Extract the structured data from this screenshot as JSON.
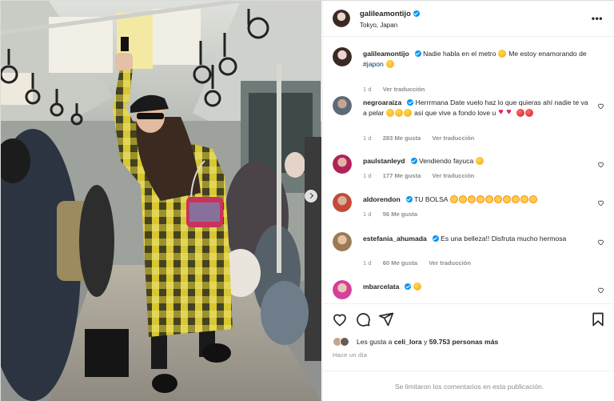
{
  "post": {
    "username": "galileamontijo",
    "location": "Tokyo, Japan",
    "more_icon": "more-horizontal-icon",
    "caption": {
      "username": "galileamontijo",
      "text_before": "Nadie habla en el metro",
      "text_middle": "Me estoy enamorando de",
      "hashtag": "#japon",
      "time": "1 d",
      "translation": "Ver traducción"
    }
  },
  "comments": [
    {
      "username": "negroaraiza",
      "text": "Herrrmana Date vuelo haz lo que quieras ahí nadie te va a pelar",
      "text_after": "así que vive a fondo love u",
      "time": "1 d",
      "likes": "283 Me gusta",
      "translation": "Ver traducción"
    },
    {
      "username": "paulstanleyd",
      "text": "Vendiendo fayuca",
      "time": "1 d",
      "likes": "177 Me gusta",
      "translation": "Ver traducción"
    },
    {
      "username": "aldorendon",
      "text": "TU BOLSA",
      "time": "1 d",
      "likes": "56 Me gusta"
    },
    {
      "username": "estefania_ahumada",
      "text": "Es una belleza!! Disfruta mucho hermosa",
      "time": "1 d",
      "likes": "60 Me gusta",
      "translation": "Ver traducción"
    },
    {
      "username": "mbarcelata",
      "text": ""
    }
  ],
  "actions": {
    "like_icon": "heart-icon",
    "comment_icon": "comment-icon",
    "share_icon": "send-icon",
    "save_icon": "bookmark-icon"
  },
  "likes": {
    "prefix": "Les gusta a",
    "user": "celi_lora",
    "conj": "y",
    "count": "59.753 personas más"
  },
  "time_ago": "Hace un día",
  "comments_limited": "Se limitaron los comentarios en esta publicación.",
  "colors": {
    "verified": "#0095f6",
    "link": "#00376b",
    "muted": "#8e8e8e",
    "coat_yellow": "#d9c23a"
  }
}
